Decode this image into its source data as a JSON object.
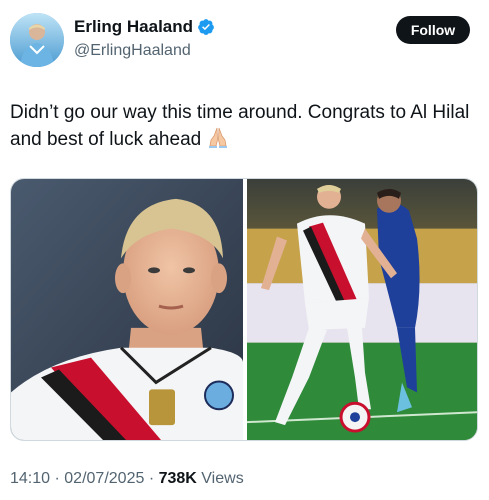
{
  "author": {
    "display_name": "Erling Haaland",
    "handle": "@ErlingHaaland",
    "verified": true,
    "verified_color": "#1d9bf0"
  },
  "follow_button": {
    "label": "Follow"
  },
  "tweet": {
    "text": "Didn’t go our way this time around. Congrats to Al Hilal and best of luck ahead",
    "emoji": "folded-hands"
  },
  "media": {
    "images": [
      {
        "description_icon": "player-portrait-photo"
      },
      {
        "description_icon": "match-action-photo"
      }
    ]
  },
  "meta": {
    "time": "14:10",
    "separator": "·",
    "date": "02/07/2025",
    "views_count": "738K",
    "views_label": "Views"
  },
  "colors": {
    "text_primary": "#0f1419",
    "text_secondary": "#536471",
    "button_bg": "#0f1419"
  }
}
